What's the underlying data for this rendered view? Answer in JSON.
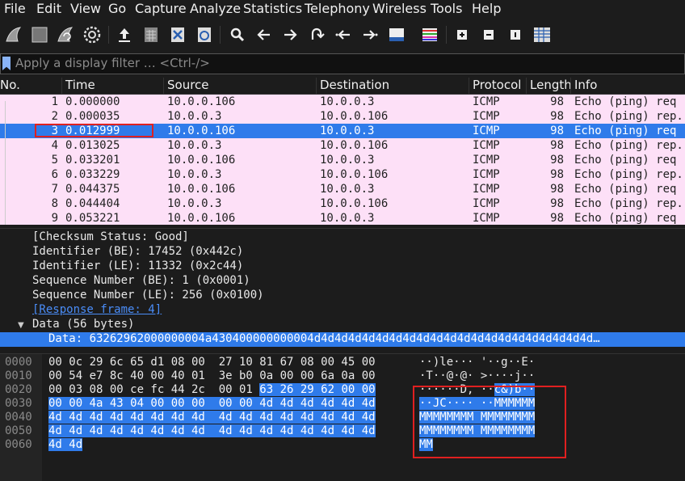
{
  "menu": [
    "File",
    "Edit",
    "View",
    "Go",
    "Capture",
    "Analyze",
    "Statistics",
    "Telephony",
    "Wireless",
    "Tools",
    "Help"
  ],
  "toolbar": {
    "icons": [
      "shark-fin-start-icon",
      "stop-capture-icon",
      "restart-capture-icon",
      "capture-options-icon",
      "open-file-icon",
      "save-file-icon",
      "close-file-icon",
      "reload-file-icon",
      "find-packet-icon",
      "go-back-icon",
      "go-forward-icon",
      "go-to-packet-icon",
      "first-packet-icon",
      "last-packet-icon",
      "auto-scroll-icon",
      "colorize-icon",
      "zoom-in-icon",
      "zoom-out-icon",
      "normal-size-icon",
      "resize-columns-icon"
    ]
  },
  "filter": {
    "placeholder": "Apply a display filter … <Ctrl-/>"
  },
  "packet_list": {
    "columns": [
      "No.",
      "Time",
      "Source",
      "Destination",
      "Protocol",
      "Length",
      "Info"
    ],
    "rows": [
      {
        "no": "1",
        "time": "0.000000",
        "src": "10.0.0.106",
        "dst": "10.0.0.3",
        "proto": "ICMP",
        "len": "98",
        "info": "Echo (ping) req"
      },
      {
        "no": "2",
        "time": "0.000035",
        "src": "10.0.0.3",
        "dst": "10.0.0.106",
        "proto": "ICMP",
        "len": "98",
        "info": "Echo (ping) rep."
      },
      {
        "no": "3",
        "time": "0.012999",
        "src": "10.0.0.106",
        "dst": "10.0.0.3",
        "proto": "ICMP",
        "len": "98",
        "info": "Echo (ping) req"
      },
      {
        "no": "4",
        "time": "0.013025",
        "src": "10.0.0.3",
        "dst": "10.0.0.106",
        "proto": "ICMP",
        "len": "98",
        "info": "Echo (ping) rep."
      },
      {
        "no": "5",
        "time": "0.033201",
        "src": "10.0.0.106",
        "dst": "10.0.0.3",
        "proto": "ICMP",
        "len": "98",
        "info": "Echo (ping) req"
      },
      {
        "no": "6",
        "time": "0.033229",
        "src": "10.0.0.3",
        "dst": "10.0.0.106",
        "proto": "ICMP",
        "len": "98",
        "info": "Echo (ping) rep."
      },
      {
        "no": "7",
        "time": "0.044375",
        "src": "10.0.0.106",
        "dst": "10.0.0.3",
        "proto": "ICMP",
        "len": "98",
        "info": "Echo (ping) req"
      },
      {
        "no": "8",
        "time": "0.044404",
        "src": "10.0.0.3",
        "dst": "10.0.0.106",
        "proto": "ICMP",
        "len": "98",
        "info": "Echo (ping) rep."
      },
      {
        "no": "9",
        "time": "0.053221",
        "src": "10.0.0.106",
        "dst": "10.0.0.3",
        "proto": "ICMP",
        "len": "98",
        "info": "Echo (ping) req"
      }
    ],
    "selected_no": "3"
  },
  "details": {
    "lines": [
      "[Checksum Status: Good]",
      "Identifier (BE): 17452 (0x442c)",
      "Identifier (LE): 11332 (0x2c44)",
      "Sequence Number (BE): 1 (0x0001)",
      "Sequence Number (LE): 256 (0x0100)"
    ],
    "response_link": "[Response frame: 4]",
    "data_node": "Data (56 bytes)",
    "data_selected": "Data: 63262962000000004a430400000000004d4d4d4d4d4d4d4d4d4d4d4d4d4d4d4d4d4d4d4d4d…"
  },
  "hex": {
    "offsets": [
      "0000",
      "0010",
      "0020",
      "0030",
      "0040",
      "0050",
      "0060"
    ],
    "rows": [
      {
        "a": "00 0c 29 6c 65 d1 08 00  27 10 81 67 08 00 45 00",
        "b": "",
        "ascii_a": "··)le··· '··g··E·",
        "ascii_b": ""
      },
      {
        "a": "00 54 e7 8c 40 00 40 01  3e b0 0a 00 00 6a 0a 00",
        "b": "",
        "ascii_a": "·T··@·@· >····j··",
        "ascii_b": ""
      },
      {
        "a": "00 03 08 00 ce fc 44 2c  00 01 ",
        "b": "63 26 29 62 00 00",
        "ascii_a": "······D, ··",
        "ascii_b": "c&)b··"
      },
      {
        "a": "",
        "b": "00 00 4a 43 04 00 00 00  00 00 4d 4d 4d 4d 4d 4d",
        "ascii_a": "",
        "ascii_b": "··JC···· ··MMMMMM"
      },
      {
        "a": "",
        "b": "4d 4d 4d 4d 4d 4d 4d 4d  4d 4d 4d 4d 4d 4d 4d 4d",
        "ascii_a": "",
        "ascii_b": "MMMMMMMM MMMMMMMM"
      },
      {
        "a": "",
        "b": "4d 4d 4d 4d 4d 4d 4d 4d  4d 4d 4d 4d 4d 4d 4d 4d",
        "ascii_a": "",
        "ascii_b": "MMMMMMMM MMMMMMMM"
      },
      {
        "a": "",
        "b": "4d 4d",
        "ascii_a": "",
        "ascii_b": "MM"
      }
    ]
  }
}
